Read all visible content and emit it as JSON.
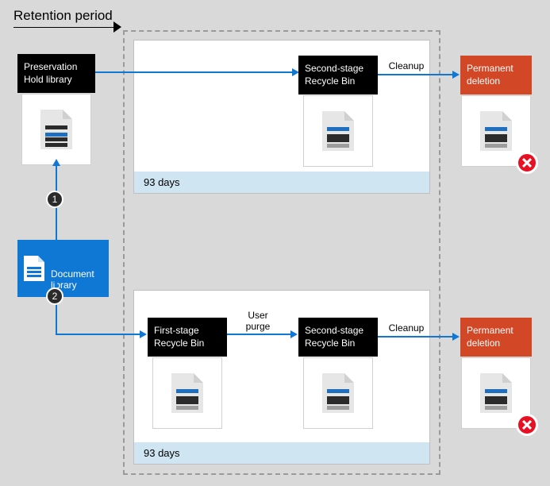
{
  "title": "Retention period",
  "retention_duration": "93 days",
  "doc_library": {
    "label": "Document\nlibrary"
  },
  "preservation": {
    "label": "Preservation\nHold library"
  },
  "steps": {
    "one": "1",
    "two": "2"
  },
  "path_top": {
    "second_stage": "Second-stage\nRecycle Bin",
    "cleanup": "Cleanup",
    "permanent": "Permanent\ndeletion",
    "panel_days": "93 days"
  },
  "path_bottom": {
    "first_stage": "First-stage\nRecycle Bin",
    "user_purge": "User\npurge",
    "second_stage": "Second-stage\nRecycle Bin",
    "cleanup": "Cleanup",
    "permanent": "Permanent\ndeletion",
    "panel_days": "93 days"
  }
}
